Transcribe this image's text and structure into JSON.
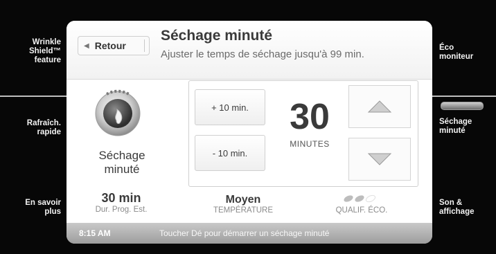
{
  "sidebar_left": [
    {
      "label": "Wrinkle\nShield™\nfeature"
    },
    {
      "label": "Rafraîch.\nrapide"
    },
    {
      "label": "En savoir\nplus"
    }
  ],
  "sidebar_right": [
    {
      "label": "Éco\nmoniteur"
    },
    {
      "label": "Séchage\nminuté"
    },
    {
      "label": "Son &\naffichage"
    }
  ],
  "header": {
    "back_label": "Retour",
    "title": "Séchage minuté",
    "subtitle": "Ajuster le temps de séchage jusqu'à 99 min."
  },
  "cycle": {
    "label": "Séchage minuté",
    "icon": "dryer-flame-icon"
  },
  "controls": {
    "plus_label": "+ 10 min.",
    "minus_label": "- 10 min.",
    "value": "30",
    "unit": "MINUTES"
  },
  "stats": {
    "duration_value": "30 min",
    "duration_label": "Dur. Prog. Est.",
    "temperature_value": "Moyen",
    "temperature_label": "TEMPÉRATURE",
    "eco_label": "QUALIF. ÉCO.",
    "eco_leaves_filled": 2,
    "eco_leaves_total": 3
  },
  "footer": {
    "time": "8:15 AM",
    "message": "Toucher Dé pour démarrer un séchage minuté"
  },
  "colors": {
    "background": "#070707",
    "panel": "#ffffff",
    "text": "#3a3a3a",
    "footer": "#b5b5b5"
  }
}
